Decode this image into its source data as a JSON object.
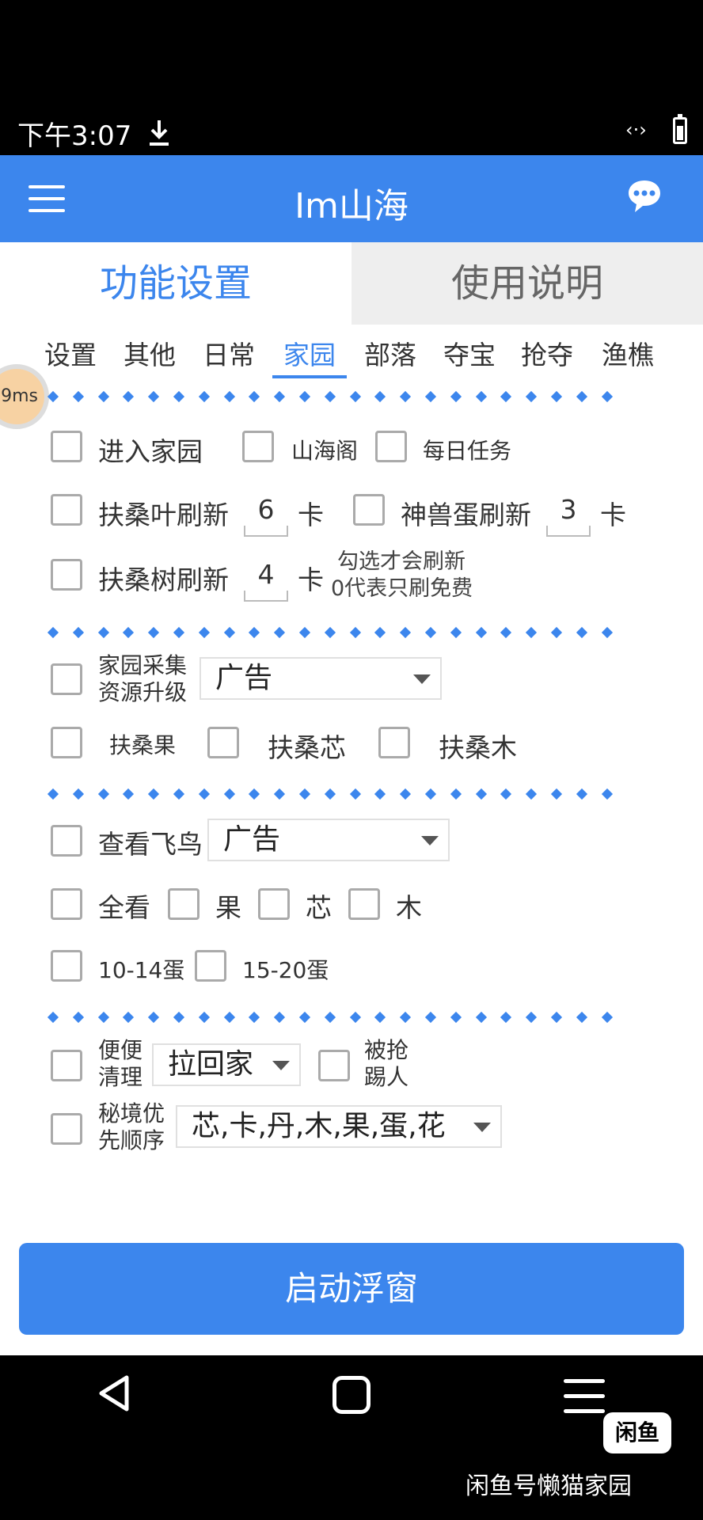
{
  "status": {
    "time": "下午3:07",
    "link": "‹·›"
  },
  "app": {
    "title": "Im山海"
  },
  "tabs": {
    "main": [
      "功能设置",
      "使用说明"
    ],
    "sub": [
      "设置",
      "其他",
      "日常",
      "家园",
      "部落",
      "夺宝",
      "抢夺",
      "渔樵"
    ],
    "active_sub": "家园"
  },
  "latency": "9ms",
  "row1": {
    "enter_home": "进入家园",
    "shanhai_pavilion": "山海阁",
    "daily_task": "每日任务"
  },
  "row2": {
    "fusang_leaf": "扶桑叶刷新",
    "leaf_count": "6",
    "leaf_unit": "卡",
    "beast_egg": "神兽蛋刷新",
    "egg_count": "3",
    "egg_unit": "卡"
  },
  "row3": {
    "fusang_tree": "扶桑树刷新",
    "tree_count": "4",
    "tree_unit": "卡",
    "note_line1": "勾选才会刷新",
    "note_line2": "0代表只刷免费"
  },
  "collect": {
    "label_line1": "家园采集",
    "label_line2": "资源升级",
    "select_value": "广告"
  },
  "collect_items": {
    "fruit": "扶桑果",
    "core": "扶桑芯",
    "wood": "扶桑木"
  },
  "bird": {
    "label": "查看飞鸟",
    "select_value": "广告"
  },
  "view": {
    "all": "全看",
    "fruit": "果",
    "core": "芯",
    "wood": "木"
  },
  "eggs": {
    "range1": "10-14蛋",
    "range2": "15-20蛋"
  },
  "clean": {
    "label_line1": "便便",
    "label_line2": "清理",
    "select_value": "拉回家",
    "kicked_line1": "被抢",
    "kicked_line2": "踢人"
  },
  "secret": {
    "label_line1": "秘境优",
    "label_line2": "先顺序",
    "select_value": "芯,卡,丹,木,果,蛋,花"
  },
  "start_button": "启动浮窗",
  "watermark": {
    "logo": "闲鱼",
    "text": "闲鱼号懒猫家园"
  },
  "colors": {
    "accent": "#3c86ed",
    "status_bar": "#000000",
    "inactive_tab": "#eeeeee"
  },
  "icons": [
    "menu-icon",
    "chat-icon",
    "download-icon",
    "battery-icon",
    "back-icon",
    "home-icon",
    "recents-icon"
  ]
}
